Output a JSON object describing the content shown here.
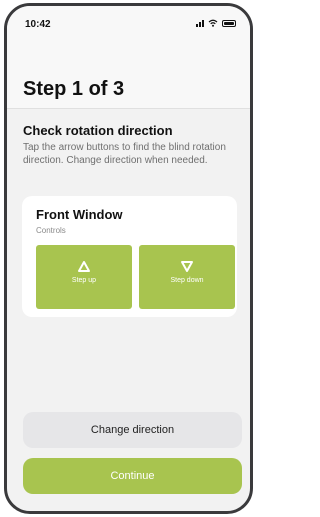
{
  "status_bar": {
    "time": "10:42"
  },
  "header": {
    "title": "Step 1 of 3"
  },
  "instructions": {
    "title": "Check rotation direction",
    "description": "Tap the arrow buttons to find the blind rotation direction. Change direction when needed."
  },
  "card": {
    "title": "Front Window",
    "subtitle": "Controls",
    "step_up_label": "Step up",
    "step_down_label": "Step down",
    "accent_color": "#a8c44f"
  },
  "actions": {
    "change_direction_label": "Change direction",
    "continue_label": "Continue"
  }
}
